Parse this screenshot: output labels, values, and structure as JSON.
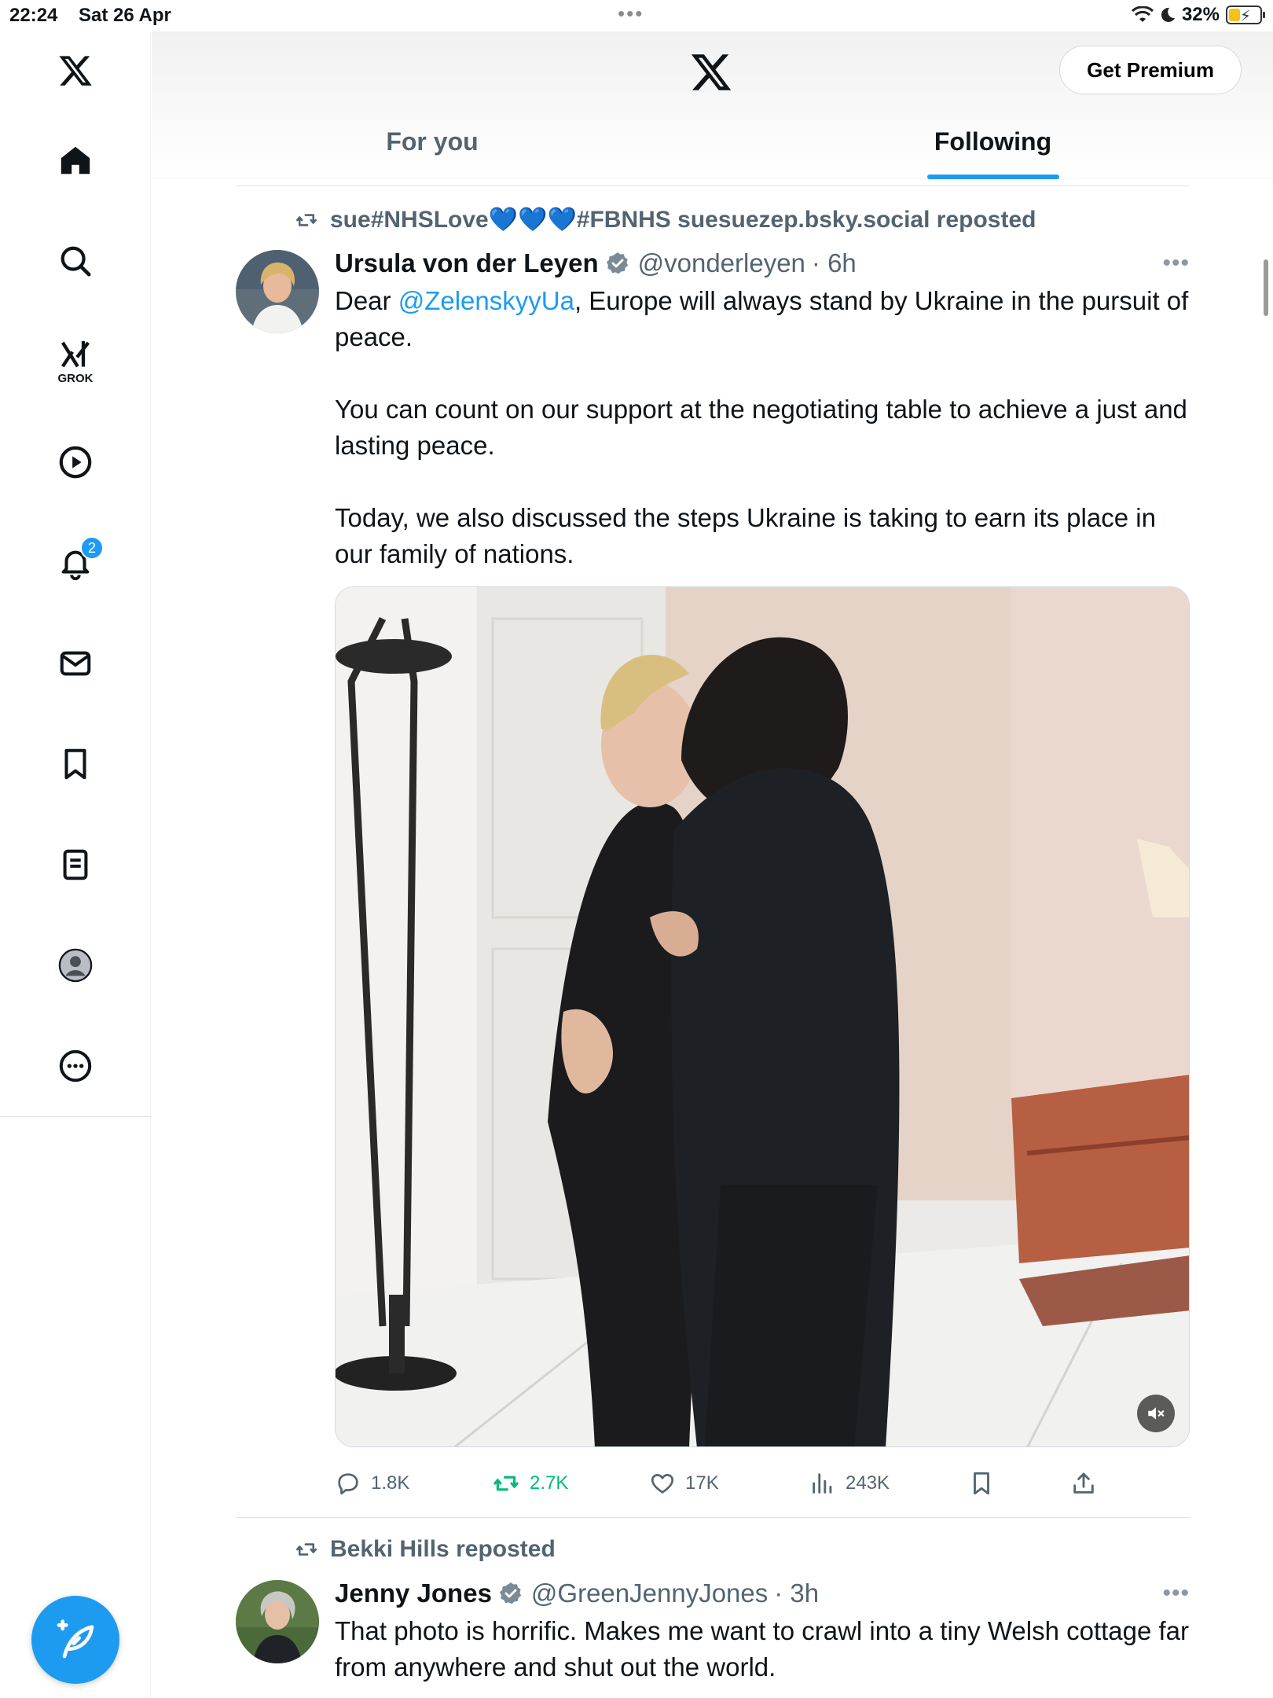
{
  "status_bar": {
    "time": "22:24",
    "date": "Sat 26 Apr",
    "battery": "32%"
  },
  "header": {
    "premium_label": "Get Premium",
    "tabs": [
      {
        "label": "For you"
      },
      {
        "label": "Following"
      }
    ]
  },
  "sidebar": {
    "grok_label": "GROK",
    "notification_count": "2"
  },
  "tweets": [
    {
      "repost_text": "sue#NHSLove💙💙💙#FBNHS suesuezep.bsky.social reposted",
      "name": "Ursula von der Leyen",
      "handle": "@vonderleyen",
      "time": "· 6h",
      "text_p1_before": "Dear ",
      "mention": "@ZelenskyyUa",
      "text_p1_after": ", Europe will always stand by Ukraine in the pursuit of peace.",
      "text_p2": "You can count on our support at the negotiating table to achieve a just and lasting peace.",
      "text_p3": "Today, we also discussed the steps Ukraine is taking to earn its place in our family of nations.",
      "stats": {
        "replies": "1.8K",
        "reposts": "2.7K",
        "likes": "17K",
        "views": "243K"
      }
    },
    {
      "repost_text": "Bekki Hills reposted",
      "name": "Jenny Jones",
      "handle": "@GreenJennyJones",
      "time": "· 3h",
      "text": "That photo is horrific. Makes me want to crawl into a tiny Welsh cottage far from anywhere and shut out the world."
    }
  ],
  "colors": {
    "accent": "#1d9bf0",
    "repost_green": "#00ba7c",
    "secondary_text": "#536471"
  }
}
